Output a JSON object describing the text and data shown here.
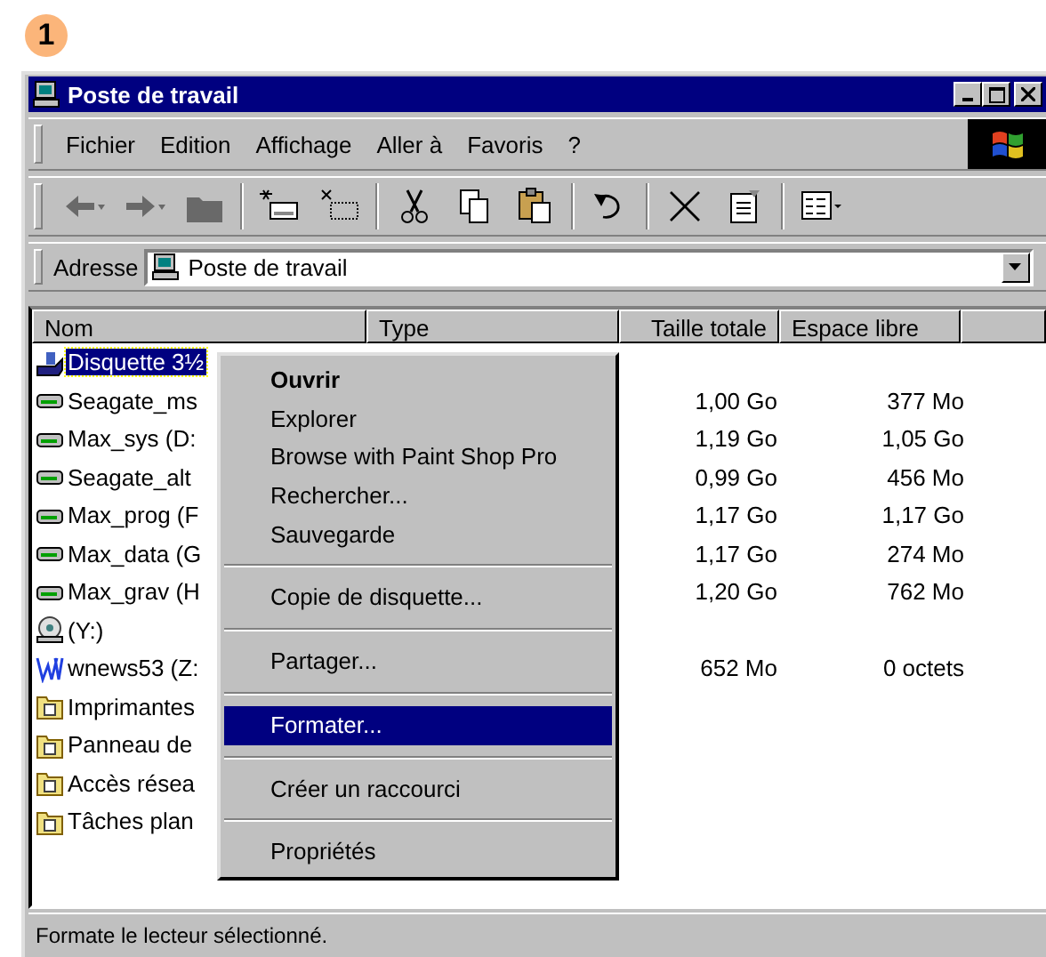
{
  "step_badge": "1",
  "window": {
    "title": "Poste de travail"
  },
  "menu_bar": [
    "Fichier",
    "Edition",
    "Affichage",
    "Aller à",
    "Favoris",
    "?"
  ],
  "toolbar": [
    {
      "kind": "back",
      "disabled": true
    },
    {
      "kind": "forward",
      "disabled": true
    },
    {
      "kind": "up",
      "disabled": true
    },
    {
      "kind": "map",
      "disabled": false
    },
    {
      "kind": "disconnect",
      "disabled": false
    },
    {
      "kind": "cut",
      "disabled": false
    },
    {
      "kind": "copy",
      "disabled": false
    },
    {
      "kind": "paste",
      "disabled": false
    },
    {
      "kind": "undo",
      "disabled": false
    },
    {
      "kind": "delete",
      "disabled": false
    },
    {
      "kind": "properties",
      "disabled": false
    },
    {
      "kind": "views",
      "disabled": false
    }
  ],
  "address": {
    "label": "Adresse",
    "value": "Poste de travail"
  },
  "table": {
    "columns": [
      "Nom",
      "Type",
      "Taille totale",
      "Espace libre"
    ],
    "rows": [
      {
        "kind": "floppy",
        "name": "Disquette 3½",
        "size": "",
        "free": "",
        "selected": true
      },
      {
        "kind": "drive",
        "name": "Seagate_ms",
        "size": "1,00 Go",
        "free": "377 Mo",
        "selected": false
      },
      {
        "kind": "drive",
        "name": "Max_sys (D:",
        "size": "1,19 Go",
        "free": "1,05 Go",
        "selected": false
      },
      {
        "kind": "drive",
        "name": "Seagate_alt",
        "size": "0,99 Go",
        "free": "456 Mo",
        "selected": false
      },
      {
        "kind": "drive",
        "name": "Max_prog (F",
        "size": "1,17 Go",
        "free": "1,17 Go",
        "selected": false
      },
      {
        "kind": "drive",
        "name": "Max_data (G",
        "size": "1,17 Go",
        "free": "274 Mo",
        "selected": false
      },
      {
        "kind": "drive",
        "name": "Max_grav (H",
        "size": "1,20 Go",
        "free": "762 Mo",
        "selected": false
      },
      {
        "kind": "cd",
        "name": "(Y:)",
        "size": "",
        "free": "",
        "selected": false
      },
      {
        "kind": "network",
        "name": "wnews53 (Z:",
        "size": "652 Mo",
        "free": "0 octets",
        "selected": false
      },
      {
        "kind": "folder",
        "name": "Imprimantes",
        "size": "",
        "free": "",
        "selected": false
      },
      {
        "kind": "folder",
        "name": "Panneau de",
        "size": "",
        "free": "",
        "selected": false
      },
      {
        "kind": "folder",
        "name": "Accès résea",
        "size": "",
        "free": "",
        "selected": false
      },
      {
        "kind": "folder",
        "name": "Tâches plan",
        "size": "",
        "free": "",
        "selected": false
      }
    ]
  },
  "context_menu": [
    {
      "kind": "item",
      "label": "Ouvrir",
      "default": true,
      "selected": false
    },
    {
      "kind": "item",
      "label": "Explorer",
      "default": false,
      "selected": false
    },
    {
      "kind": "item",
      "label": "Browse with Paint Shop Pro",
      "default": false,
      "selected": false
    },
    {
      "kind": "item",
      "label": "Rechercher...",
      "default": false,
      "selected": false
    },
    {
      "kind": "item",
      "label": "Sauvegarde",
      "default": false,
      "selected": false
    },
    {
      "kind": "separator"
    },
    {
      "kind": "item",
      "label": "Copie de disquette...",
      "default": false,
      "selected": false
    },
    {
      "kind": "separator"
    },
    {
      "kind": "item",
      "label": "Partager...",
      "default": false,
      "selected": false
    },
    {
      "kind": "separator"
    },
    {
      "kind": "item",
      "label": "Formater...",
      "default": false,
      "selected": true
    },
    {
      "kind": "separator"
    },
    {
      "kind": "item",
      "label": "Créer un raccourci",
      "default": false,
      "selected": false
    },
    {
      "kind": "separator"
    },
    {
      "kind": "item",
      "label": "Propriétés",
      "default": false,
      "selected": false
    }
  ],
  "status_bar": "Formate le lecteur sélectionné."
}
